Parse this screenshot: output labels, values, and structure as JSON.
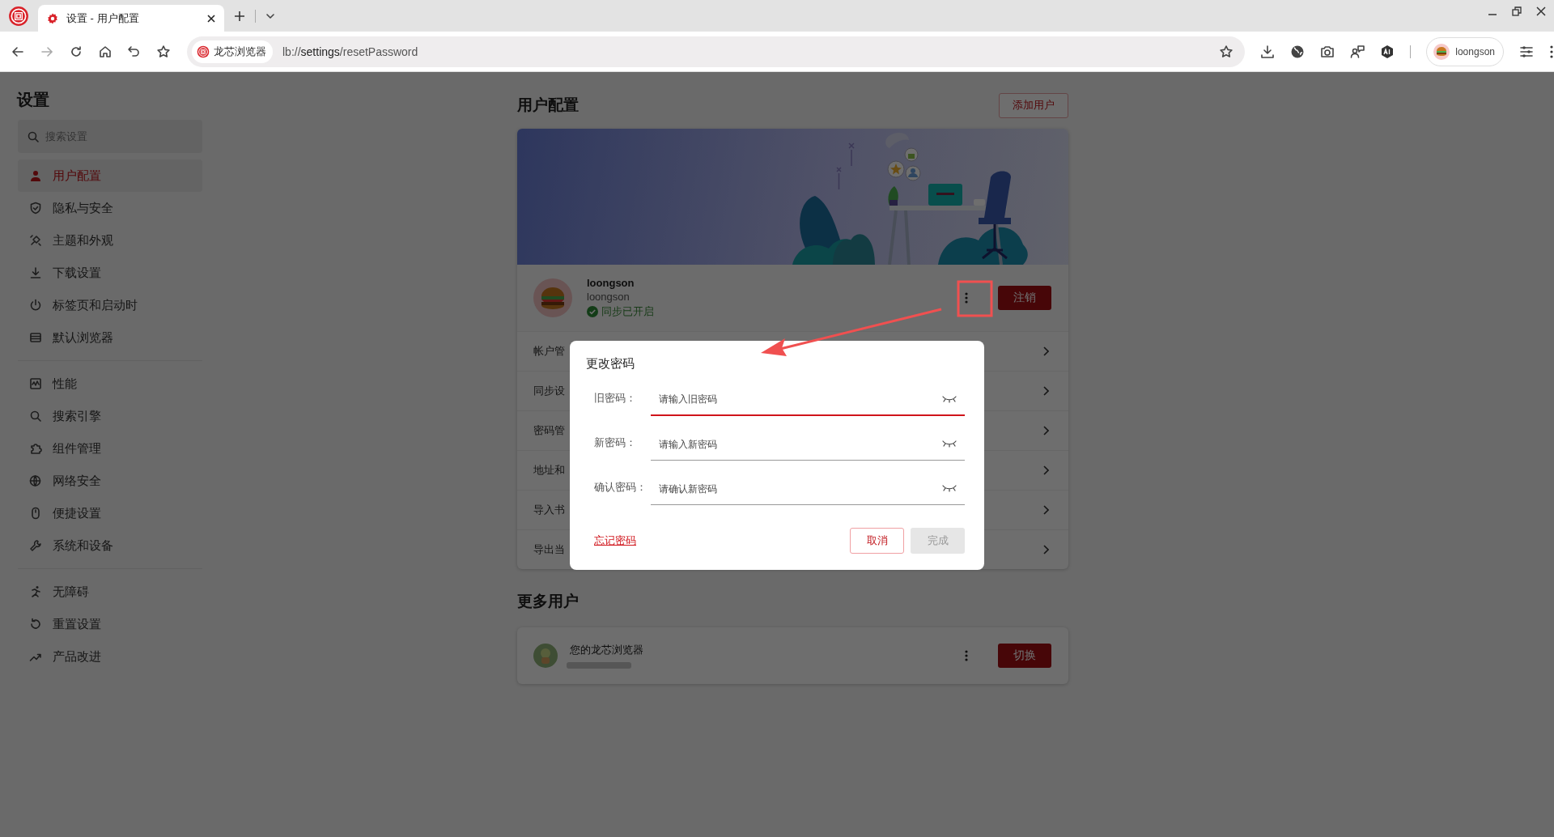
{
  "browser": {
    "tab_title": "设置 - 用户配置",
    "site_badge": "龙芯浏览器",
    "url": "lb://**settings**/resetPassword",
    "profile_name": "loongson"
  },
  "sidebar": {
    "title": "设置",
    "search_placeholder": "搜索设置",
    "groups": [
      {
        "items": [
          {
            "label": "用户配置",
            "selected": true
          },
          {
            "label": "隐私与安全",
            "selected": false
          },
          {
            "label": "主题和外观",
            "selected": false
          },
          {
            "label": "下载设置",
            "selected": false
          },
          {
            "label": "标签页和启动时",
            "selected": false
          },
          {
            "label": "默认浏览器",
            "selected": false
          }
        ]
      },
      {
        "items": [
          {
            "label": "性能",
            "selected": false
          },
          {
            "label": "搜索引擎",
            "selected": false
          },
          {
            "label": "组件管理",
            "selected": false
          },
          {
            "label": "网络安全",
            "selected": false
          },
          {
            "label": "便捷设置",
            "selected": false
          },
          {
            "label": "系统和设备",
            "selected": false
          }
        ]
      },
      {
        "items": [
          {
            "label": "无障碍",
            "selected": false
          },
          {
            "label": "重置设置",
            "selected": false
          },
          {
            "label": "产品改进",
            "selected": false
          }
        ]
      }
    ]
  },
  "main": {
    "title": "用户配置",
    "add_user_button": "添加用户",
    "profile": {
      "display_name": "loongson",
      "account": "loongson",
      "sync_status": "同步已开启",
      "logout_button": "注销"
    },
    "rows": [
      {
        "label": "帐户管"
      },
      {
        "label": "同步设"
      },
      {
        "label": "密码管"
      },
      {
        "label": "地址和"
      },
      {
        "label": "导入书"
      },
      {
        "label": "导出当"
      }
    ],
    "more_users_title": "更多用户",
    "other_users": [
      {
        "name": "您的龙芯浏览器",
        "switch_button": "切换"
      }
    ]
  },
  "dialog": {
    "title": "更改密码",
    "fields": [
      {
        "label": "旧密码：",
        "placeholder": "请输入旧密码",
        "focused": true
      },
      {
        "label": "新密码：",
        "placeholder": "请输入新密码",
        "focused": false
      },
      {
        "label": "确认密码：",
        "placeholder": "请确认新密码",
        "focused": false
      }
    ],
    "forgot_link": "忘记密码",
    "cancel_button": "取消",
    "confirm_button": {
      "label": "完成",
      "disabled": true
    }
  }
}
